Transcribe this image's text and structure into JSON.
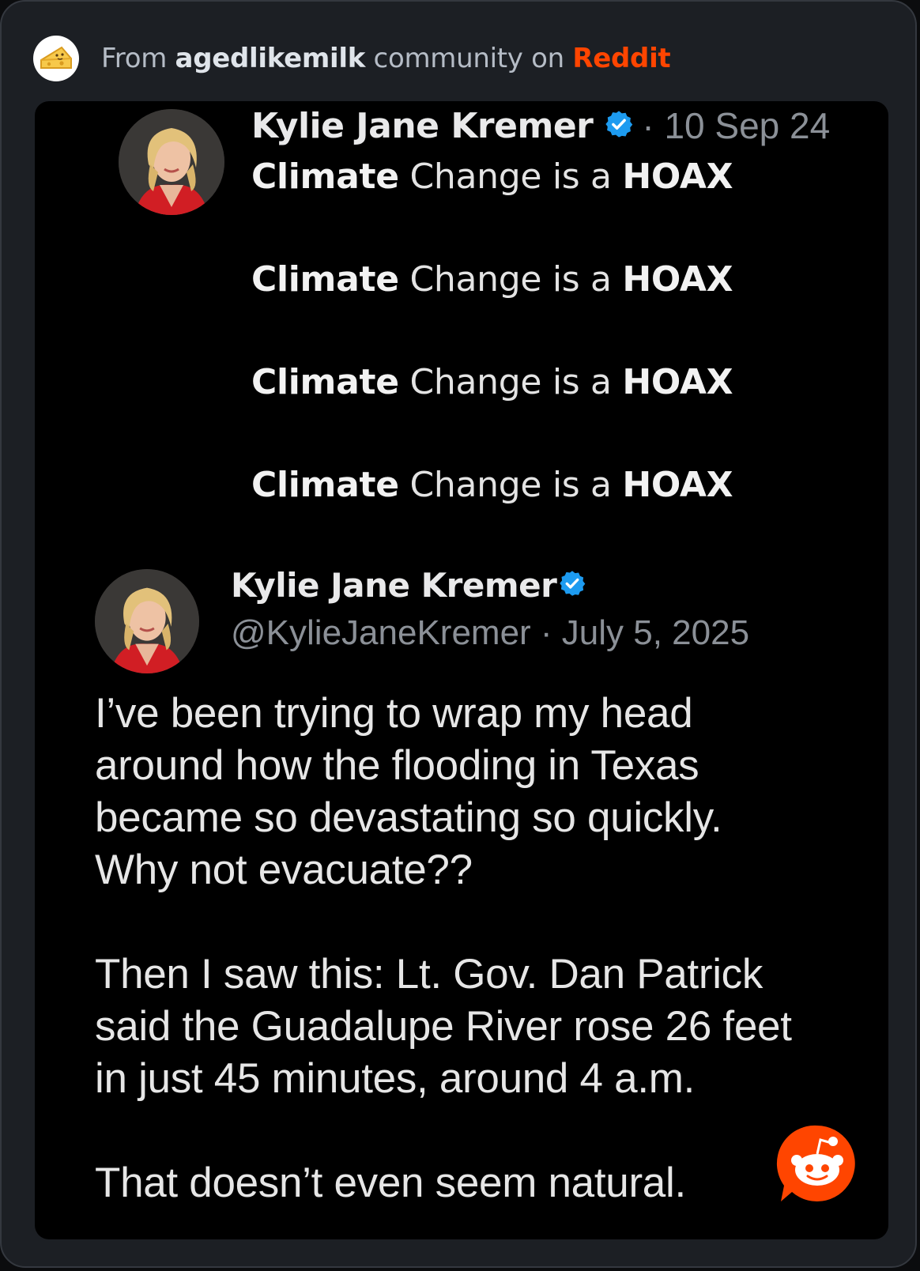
{
  "header": {
    "from": "From ",
    "community": "agedlikemilk",
    "middle": " community on ",
    "platform": "Reddit"
  },
  "tweet1": {
    "name": "Kylie Jane Kremer",
    "date": "· 10 Sep 24",
    "lines": [
      {
        "bold1": "Climate",
        "normal": " Change is a ",
        "bold2": "HOAX"
      },
      {
        "bold1": "Climate",
        "normal": " Change is a ",
        "bold2": "HOAX"
      },
      {
        "bold1": "Climate",
        "normal": " Change is a ",
        "bold2": "HOAX"
      },
      {
        "bold1": "Climate",
        "normal": " Change is a ",
        "bold2": "HOAX"
      }
    ]
  },
  "tweet2": {
    "name": "Kylie Jane Kremer",
    "handle_line": "@KylieJaneKremer · July 5, 2025",
    "paragraph1": [
      "I’ve been trying to wrap my head",
      "around how the flooding in Texas",
      "became so devastating so quickly.",
      "Why not evacuate??"
    ],
    "paragraph2": [
      "Then I saw this: Lt. Gov. Dan Patrick",
      "said the Guadalupe River rose 26 feet",
      "in just 45 minutes, around 4 a.m."
    ],
    "paragraph3": [
      "That doesn’t even seem natural."
    ]
  },
  "colors": {
    "reddit_orange": "#ff4500",
    "verified_blue": "#1d9bf0",
    "card_bg": "#1c1f24",
    "post_bg": "#000000"
  },
  "icons": {
    "community_avatar": "cheese-icon",
    "verified": "verified-badge-icon",
    "fab": "reddit-snoo-icon"
  }
}
